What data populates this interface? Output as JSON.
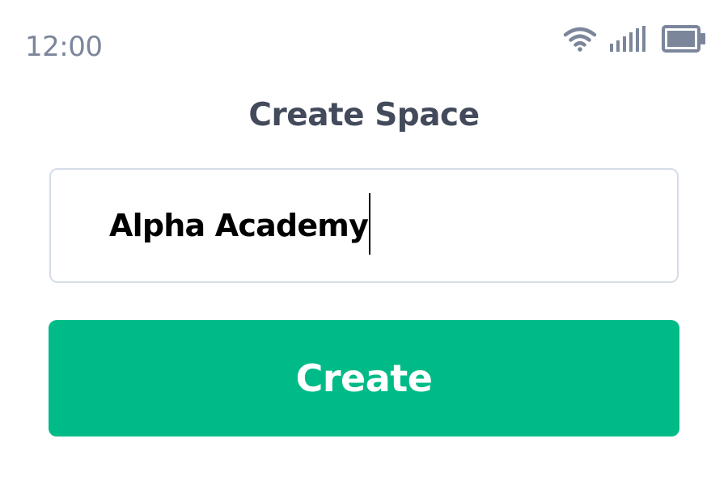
{
  "status_bar": {
    "time": "12:00",
    "icons": [
      "wifi-icon",
      "cellular-signal-icon",
      "battery-icon"
    ],
    "icon_color": "#7b869b"
  },
  "header": {
    "title": "Create Space"
  },
  "form": {
    "space_name_value": "Alpha Academy",
    "create_label": "Create"
  },
  "colors": {
    "accent": "#00bb87",
    "title": "#424a5b",
    "field_border": "#d6dce8",
    "status": "#7b869b"
  }
}
